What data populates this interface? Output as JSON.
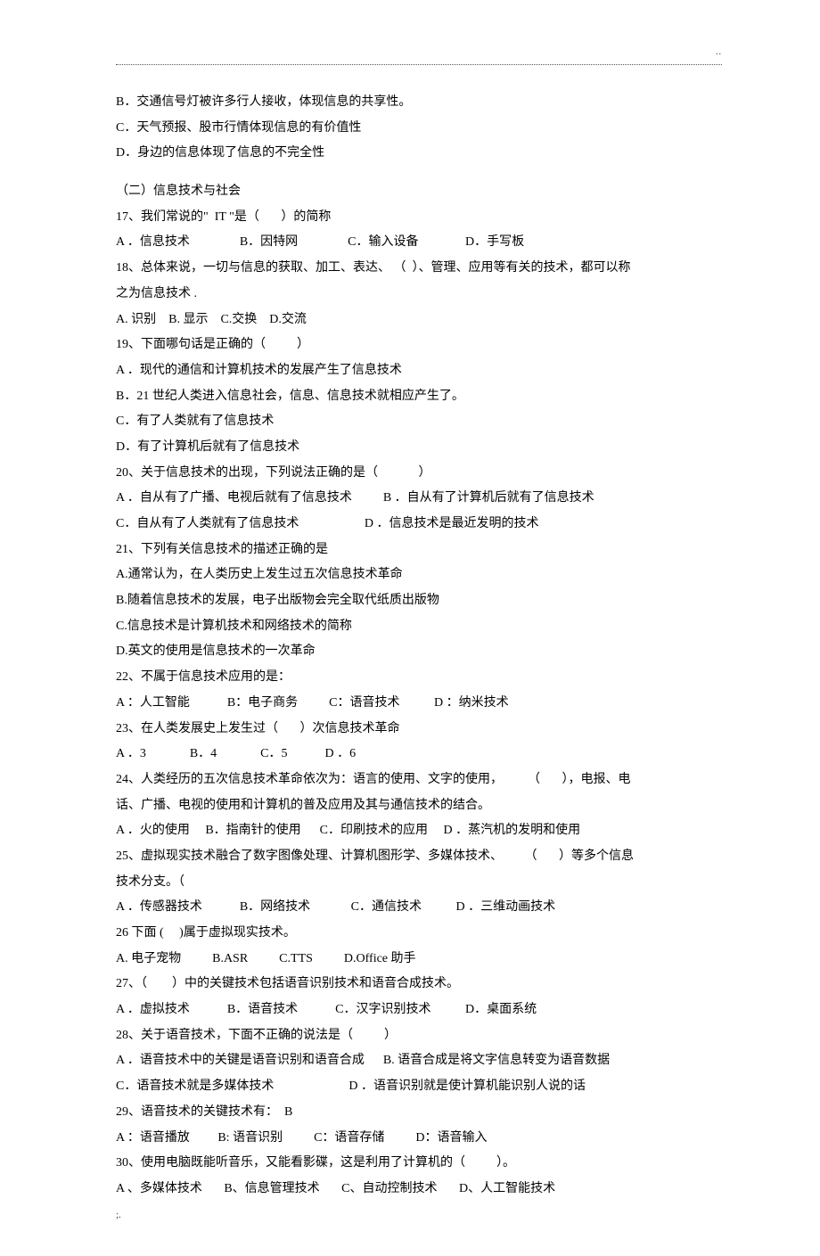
{
  "lines": [
    {
      "t": "B．交通信号灯被许多行人接收，体现信息的共享性。"
    },
    {
      "t": "C．天气预报、股市行情体现信息的有价值性"
    },
    {
      "t": "D．身边的信息体现了信息的不完全性"
    },
    {
      "t": "（二）信息技术与社会",
      "sp": true
    },
    {
      "t": "17、我们常说的\"  IT \"是（       ）的简称"
    },
    {
      "t": "A ．信息技术                B．因特网                C．输入设备               D．手写板"
    },
    {
      "t": "18、总体来说，一切与信息的获取、加工、表达、 （  ）、管理、应用等有关的技术，都可以称"
    },
    {
      "t": "之为信息技术 ."
    },
    {
      "t": "A. 识别    B. 显示    C.交换    D.交流"
    },
    {
      "t": "19、下面哪句话是正确的（          ）"
    },
    {
      "t": "A ．现代的通信和计算机技术的发展产生了信息技术"
    },
    {
      "t": "B．21 世纪人类进入信息社会，信息、信息技术就相应产生了。"
    },
    {
      "t": "C．有了人类就有了信息技术"
    },
    {
      "t": "D．有了计算机后就有了信息技术"
    },
    {
      "t": "20、关于信息技术的出现，下列说法正确的是（             ）"
    },
    {
      "t": "A ．自从有了广播、电视后就有了信息技术          B ．自从有了计算机后就有了信息技术"
    },
    {
      "t": "C．自从有了人类就有了信息技术                     D ．信息技术是最近发明的技术"
    },
    {
      "t": "21、下列有关信息技术的描述正确的是"
    },
    {
      "t": "A.通常认为，在人类历史上发生过五次信息技术革命"
    },
    {
      "t": "B.随着信息技术的发展，电子出版物会完全取代纸质出版物"
    },
    {
      "t": "C.信息技术是计算机技术和网络技术的简称"
    },
    {
      "t": "D.英文的使用是信息技术的一次革命"
    },
    {
      "t": "22、不属于信息技术应用的是："
    },
    {
      "t": "A ：人工智能            B：电子商务          C：语音技术           D ：纳米技术"
    },
    {
      "t": "23、在人类发展史上发生过（       ）次信息技术革命"
    },
    {
      "t": "A ．3              B．4              C．5            D ．6"
    },
    {
      "t": "24、人类经历的五次信息技术革命依次为：语言的使用、文字的使用，        （       ），电报、电"
    },
    {
      "t": "话、广播、电视的使用和计算机的普及应用及其与通信技术的结合。"
    },
    {
      "t": "A ．火的使用     B．指南针的使用      C．印刷技术的应用     D ．蒸汽机的发明和使用"
    },
    {
      "t": "25、虚拟现实技术融合了数字图像处理、计算机图形学、多媒体技术、       （       ）等多个信息"
    },
    {
      "t": "技术分支。（"
    },
    {
      "t": "A ．传感器技术            B．网络技术             C．通信技术           D ．三维动画技术"
    },
    {
      "t": "26 下面 (     )属于虚拟现实技术。"
    },
    {
      "t": "A. 电子宠物          B.ASR          C.TTS          D.Office 助手"
    },
    {
      "t": "27、（        ）中的关键技术包括语音识别技术和语音合成技术。"
    },
    {
      "t": "A ．虚拟技术            B．语音技术            C．汉字识别技术           D．桌面系统"
    },
    {
      "t": "28、关于语音技术，下面不正确的说法是（          ）"
    },
    {
      "t": "A ．语音技术中的关键是语音识别和语音合成      B. 语音合成是将文字信息转变为语音数据"
    },
    {
      "t": "C．语音技术就是多媒体技术                        D ．语音识别就是使计算机能识别人说的话"
    },
    {
      "t": "29、语音技术的关键技术有：  B"
    },
    {
      "t": "A ：语音播放         B: 语音识别          C：语音存储          D：语音输入"
    },
    {
      "t": "30、使用电脑既能听音乐，又能看影碟，这是利用了计算机的（          ）。"
    },
    {
      "t": "A 、多媒体技术       B、信息管理技术       C、自动控制技术       D、人工智能技术"
    }
  ],
  "footer": ";."
}
